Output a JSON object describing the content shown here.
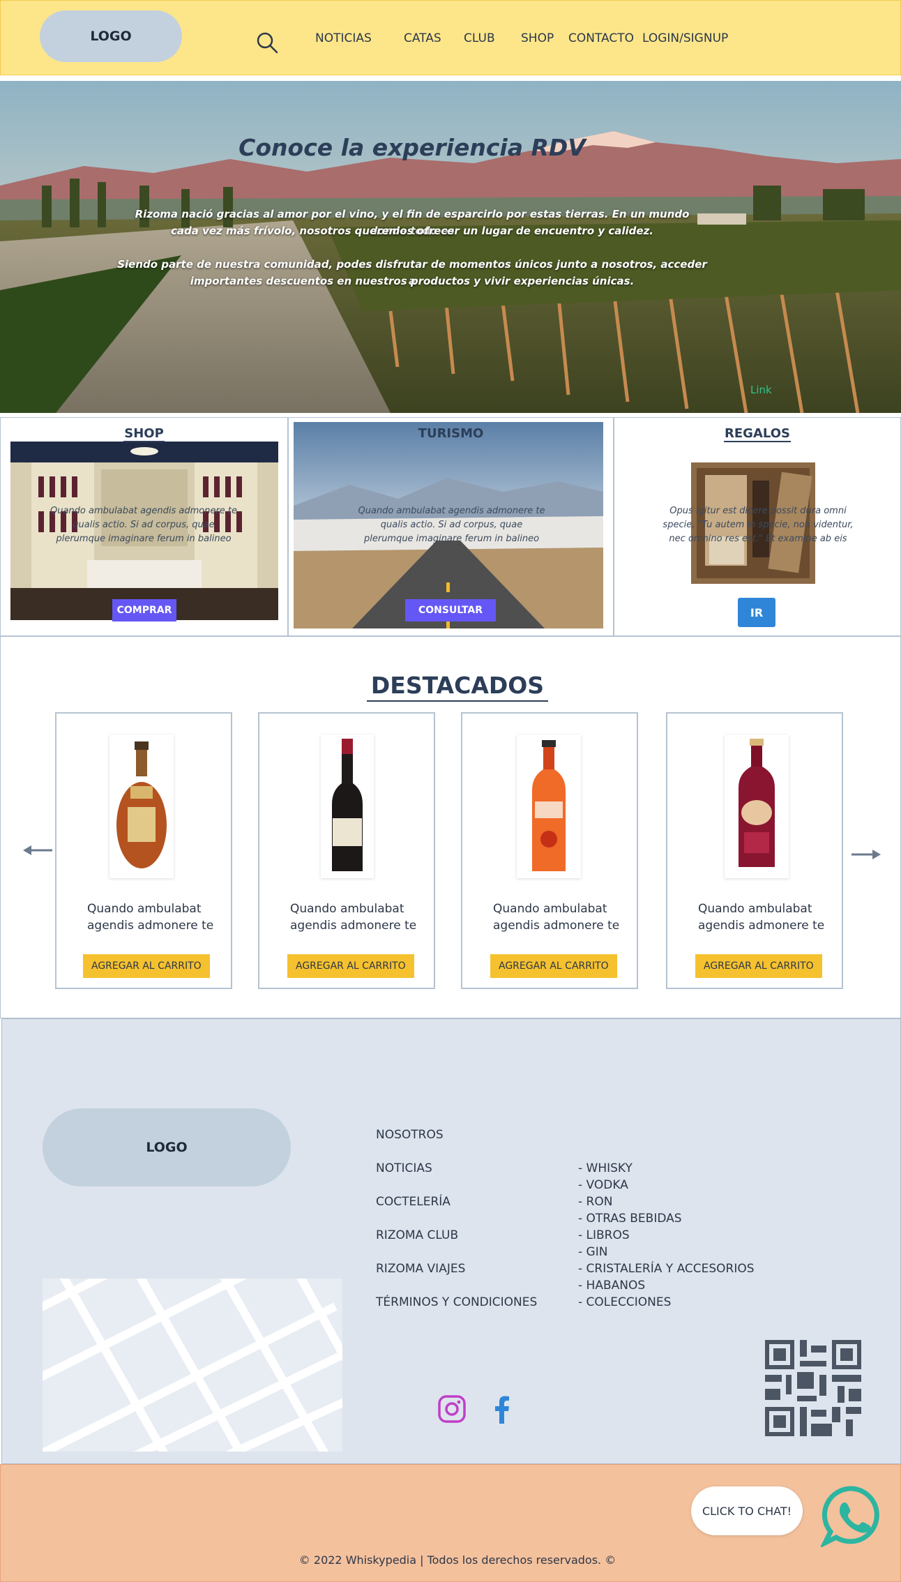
{
  "header": {
    "logo": "LOGO",
    "nav": [
      "NOTICIAS",
      "CATAS",
      "CLUB",
      "SHOP",
      "CONTACTO",
      "LOGIN/SIGNUP"
    ]
  },
  "hero": {
    "title": "Conoce la experiencia RDV",
    "paragraph1_line1": "Rizoma nació gracias al amor por el vino, y el fin de esparcirlo por estas tierras. En un mundo donde todo es",
    "paragraph1_line2": "cada vez más frívolo, nosotros queremos ofrecer un lugar de encuentro y calidez.",
    "paragraph2_line1": "Siendo parte de nuestra comunidad, podes disfrutar de momentos únicos junto a nosotros, acceder a",
    "paragraph2_line2": "importantes descuentos en nuestros productos y vivir experiencias únicas.",
    "link": "Link"
  },
  "categories": {
    "shop": {
      "title": "SHOP",
      "text": "Quando ambulabat agendis admonere te qualis actio. Si ad corpus, quae plerumque imaginare ferum in balineo",
      "button": "COMPRAR"
    },
    "turismo": {
      "title": "TURISMO",
      "text_l1": "Quando ambulabat agendis admonere te",
      "text_l2": "qualis actio. Si ad corpus, quae",
      "text_l3": "plerumque imaginare ferum in balineo",
      "button": "CONSULTAR"
    },
    "regalos": {
      "title": "REGALOS",
      "text_l1": "Opus igitur est dicere possit dura omni",
      "text_l2": "specie, \"Tu autem in specie, non videntur,",
      "text_l3": "nec omnino res est.\" Et examine ab eis",
      "button": "IR"
    }
  },
  "featured": {
    "title": "DESTACADOS",
    "products": [
      {
        "line1": "Quando ambulabat",
        "line2": "agendis admonere te",
        "button": "AGREGAR AL CARRITO"
      },
      {
        "line1": "Quando ambulabat",
        "line2": "agendis admonere te",
        "button": "AGREGAR AL CARRITO"
      },
      {
        "line1": "Quando ambulabat",
        "line2": "agendis admonere te",
        "button": "AGREGAR AL CARRITO"
      },
      {
        "line1": "Quando ambulabat",
        "line2": "agendis admonere te",
        "button": "AGREGAR AL CARRITO"
      }
    ]
  },
  "footer": {
    "logo": "LOGO",
    "links": [
      "NOSOTROS",
      "NOTICIAS",
      "COCTELERÍA",
      "RIZOMA CLUB",
      "RIZOMA VIAJES",
      "TÉRMINOS Y CONDICIONES"
    ],
    "categories": [
      "- WHISKY",
      "- VODKA",
      "- RON",
      "- OTRAS BEBIDAS",
      "- LIBROS",
      "- GIN",
      "- CRISTALERÍA Y ACCESORIOS",
      "- HABANOS",
      "- COLECCIONES"
    ]
  },
  "bottom": {
    "chat": "CLICK TO CHAT!",
    "copyright": "© 2022 Whiskypedia | Todos los derechos reservados. ©"
  },
  "colors": {
    "header_bg": "#fde68a",
    "footer_bg": "#dde4ed",
    "bottom_bg": "#f4c19d",
    "accent_violet": "#6557f5",
    "accent_blue": "#2f86d8",
    "accent_yellow": "#f5c12e",
    "whatsapp": "#2cb5a0",
    "instagram": "#c03fc7",
    "facebook": "#2f86d8"
  }
}
